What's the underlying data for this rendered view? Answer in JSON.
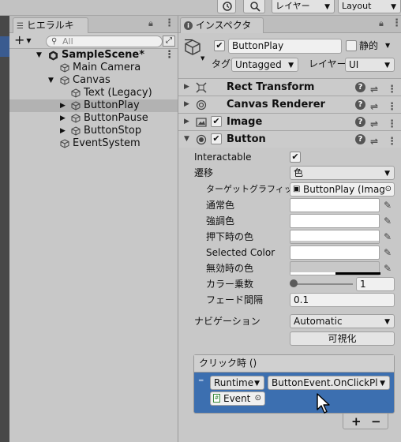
{
  "toolbar": {
    "layers_label": "レイヤー",
    "layout_label": "Layout"
  },
  "hierarchy": {
    "tab_label": "ヒエラルキー",
    "add_label": "+",
    "search_placeholder": "All",
    "scene": "SampleScene*",
    "items": [
      {
        "label": "Main Camera"
      },
      {
        "label": "Canvas"
      },
      {
        "label": "Text (Legacy)"
      },
      {
        "label": "ButtonPlay"
      },
      {
        "label": "ButtonPause"
      },
      {
        "label": "ButtonStop"
      },
      {
        "label": "EventSystem"
      }
    ]
  },
  "inspector": {
    "tab_label": "インスペクター",
    "object_name": "ButtonPlay",
    "static_label": "静的",
    "tag_label": "タグ",
    "tag_value": "Untagged",
    "layer_label": "レイヤー",
    "layer_value": "UI",
    "components": [
      {
        "name": "Rect Transform"
      },
      {
        "name": "Canvas Renderer"
      },
      {
        "name": "Image"
      },
      {
        "name": "Button"
      }
    ],
    "button": {
      "interactable_label": "Interactable",
      "transition_label": "遷移",
      "transition_value": "色",
      "target_graphic_label": "ターゲットグラフィックス",
      "target_graphic_value": "ButtonPlay (Imag",
      "normal_color_label": "通常色",
      "highlighted_color_label": "強調色",
      "pressed_color_label": "押下時の色",
      "selected_color_label": "Selected Color",
      "disabled_color_label": "無効時の色",
      "color_multiplier_label": "カラー乗数",
      "color_multiplier_value": "1",
      "color_multiplier_fraction": 0.0,
      "fade_duration_label": "フェード間隔",
      "fade_duration_value": "0.1",
      "navigation_label": "ナビゲーション",
      "navigation_value": "Automatic",
      "visualize_label": "可視化",
      "onclick_header": "クリック時 ()",
      "runtime_value": "Runtime",
      "function_value": "ButtonEvent.OnClickPla",
      "object_value": "Event",
      "add_label": "+",
      "remove_label": "−"
    }
  },
  "colors": {
    "selection_blue": "#3c6fb0",
    "panel_bg": "#c8c8c8"
  }
}
